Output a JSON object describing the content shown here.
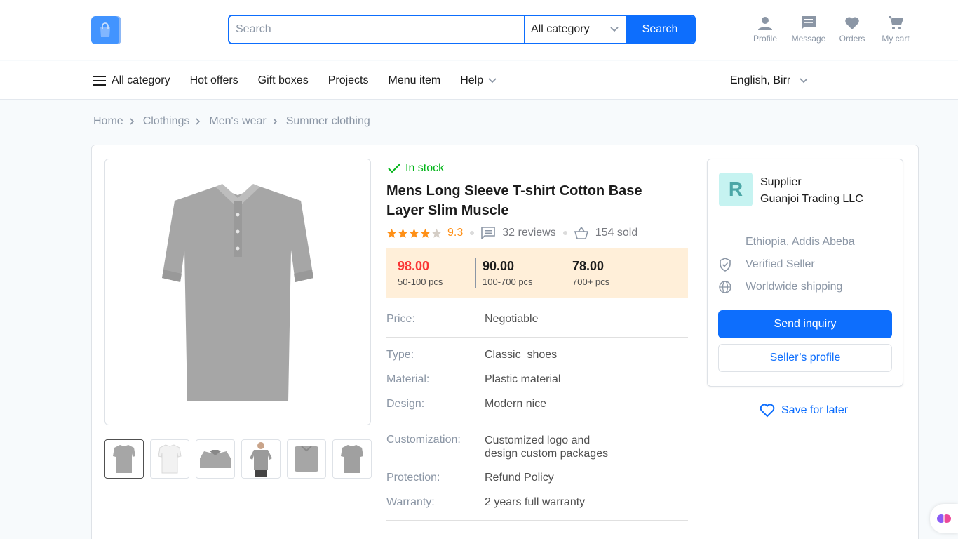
{
  "search": {
    "placeholder": "Search",
    "category": "All category",
    "button": "Search"
  },
  "header_actions": [
    {
      "label": "Profile",
      "icon": "person-icon"
    },
    {
      "label": "Message",
      "icon": "message-icon"
    },
    {
      "label": "Orders",
      "icon": "heart-icon"
    },
    {
      "label": "My cart",
      "icon": "cart-icon"
    }
  ],
  "nav": {
    "all_category": "All category",
    "items": [
      "Hot offers",
      "Gift boxes",
      "Projects",
      "Menu item"
    ],
    "help": "Help",
    "language": "English, Birr"
  },
  "breadcrumb": [
    "Home",
    "Clothings",
    "Men's wear",
    "Summer clothing"
  ],
  "product": {
    "stock": "In stock",
    "title": "Mens Long Sleeve T-shirt Cotton Base Layer Slim Muscle",
    "rating": "9.3",
    "rating_stars": 4,
    "reviews": "32 reviews",
    "sold": "154 sold",
    "tiers": [
      {
        "price": "98.00",
        "qty": "50-100 pcs"
      },
      {
        "price": "90.00",
        "qty": "100-700 pcs"
      },
      {
        "price": "78.00",
        "qty": "700+ pcs"
      }
    ],
    "specs": {
      "price_key": "Price:",
      "price_val": "Negotiable",
      "type_key": "Type:",
      "type_val": "Classic  shoes",
      "material_key": "Material:",
      "material_val": "Plastic material",
      "design_key": "Design:",
      "design_val": "Modern nice",
      "custom_key": "Customization:",
      "custom_val1": "Customized logo and",
      "custom_val2": "design custom packages",
      "protection_key": "Protection:",
      "protection_val": "Refund Policy",
      "warranty_key": "Warranty:",
      "warranty_val": "2 years full warranty"
    }
  },
  "supplier": {
    "initial": "R",
    "label": "Supplier",
    "name": "Guanjoi Trading LLC",
    "location": "Ethiopia, Addis Abeba",
    "verified": "Verified Seller",
    "shipping": "Worldwide shipping",
    "inquiry": "Send inquiry",
    "profile": "Seller’s profile",
    "save": "Save for later"
  },
  "colors": {
    "primary": "#0d6efd",
    "instock": "#00b517",
    "rating": "#ff9017",
    "price_red": "#fa3434",
    "tier_bg": "#ffefd9"
  }
}
